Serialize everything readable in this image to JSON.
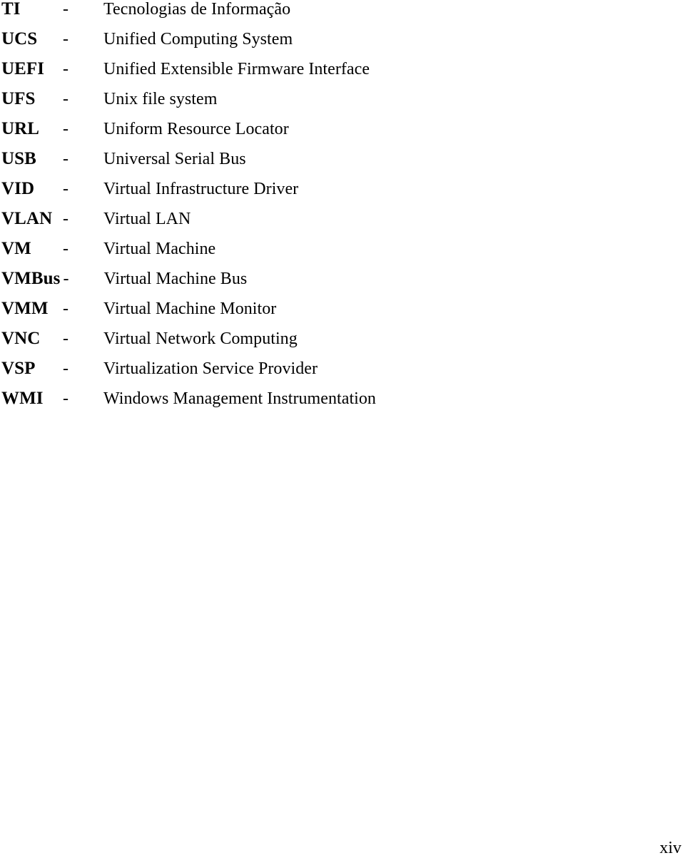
{
  "document": {
    "section_type": "list-of-abbreviations",
    "separator": "-",
    "page_number": "xiv",
    "entries": [
      {
        "term": "TI",
        "definition": "Tecnologias de Informação"
      },
      {
        "term": "UCS",
        "definition": "Unified Computing System"
      },
      {
        "term": "UEFI",
        "definition": "Unified Extensible Firmware Interface"
      },
      {
        "term": "UFS",
        "definition": "Unix file system"
      },
      {
        "term": "URL",
        "definition": "Uniform Resource Locator"
      },
      {
        "term": "USB",
        "definition": "Universal Serial Bus"
      },
      {
        "term": "VID",
        "definition": "Virtual Infrastructure Driver"
      },
      {
        "term": "VLAN",
        "definition": "Virtual LAN"
      },
      {
        "term": "VM",
        "definition": "Virtual Machine"
      },
      {
        "term": "VMBus",
        "definition": "Virtual Machine Bus"
      },
      {
        "term": "VMM",
        "definition": "Virtual Machine Monitor"
      },
      {
        "term": "VNC",
        "definition": "Virtual Network Computing"
      },
      {
        "term": "VSP",
        "definition": "Virtualization Service Provider"
      },
      {
        "term": "WMI",
        "definition": "Windows Management Instrumentation"
      }
    ]
  }
}
